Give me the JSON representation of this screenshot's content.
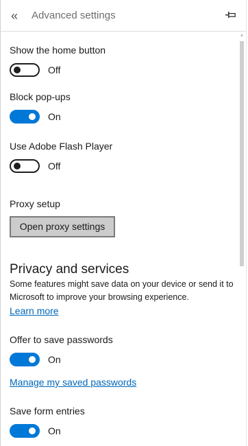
{
  "header": {
    "title": "Advanced settings",
    "back_icon": "double-chevron-left-icon",
    "pin_icon": "pin-icon"
  },
  "settings": {
    "home_button": {
      "label": "Show the home button",
      "state": "Off"
    },
    "block_popups": {
      "label": "Block pop-ups",
      "state": "On"
    },
    "flash_player": {
      "label": "Use Adobe Flash Player",
      "state": "Off"
    }
  },
  "proxy": {
    "label": "Proxy setup",
    "button_label": "Open proxy settings"
  },
  "privacy": {
    "heading": "Privacy and services",
    "description": "Some features might save data on your device or send it to Microsoft to improve your browsing experience.",
    "learn_more": "Learn more",
    "offer_passwords": {
      "label": "Offer to save passwords",
      "state": "On"
    },
    "manage_passwords": "Manage my saved passwords",
    "form_entries": {
      "label": "Save form entries",
      "state": "On"
    }
  },
  "colors": {
    "accent": "#0078d7",
    "link": "#0067b8"
  }
}
